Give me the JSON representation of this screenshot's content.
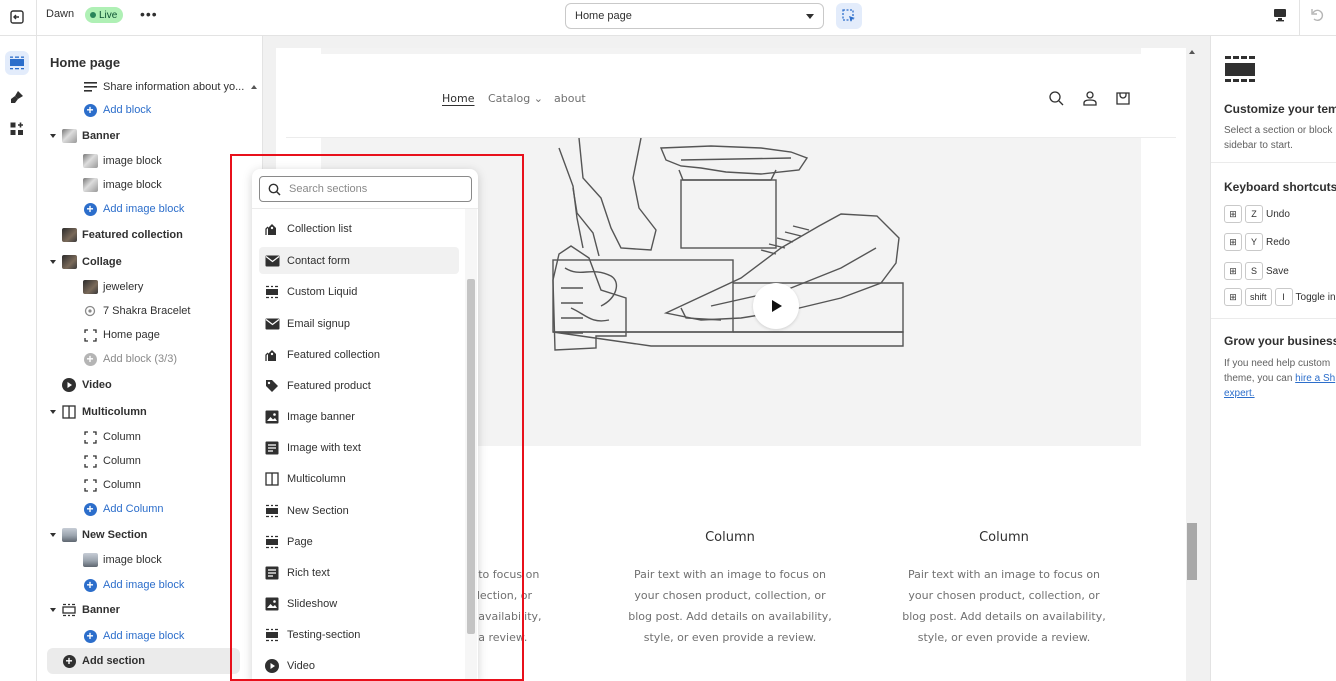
{
  "topbar": {
    "theme_name": "Dawn",
    "live_badge": "Live",
    "more_label": "•••",
    "template_select": "Home page"
  },
  "sidebar": {
    "title": "Home page",
    "items": [
      {
        "label": "Share information about yo...",
        "icon": "text-lines-icon"
      },
      {
        "label": "Add block",
        "icon": "add-circle-icon"
      },
      {
        "label": "Banner",
        "icon": "image-thumbnail"
      },
      {
        "label": "image block",
        "icon": "image-thumbnail"
      },
      {
        "label": "image block",
        "icon": "image-thumbnail"
      },
      {
        "label": "Add image block",
        "icon": "add-circle-icon"
      },
      {
        "label": "Featured collection",
        "icon": "image-thumbnail"
      },
      {
        "label": "Collage",
        "icon": "image-thumbnail"
      },
      {
        "label": "jewelery",
        "icon": "image-thumbnail"
      },
      {
        "label": "7 Shakra Bracelet",
        "icon": "product-icon"
      },
      {
        "label": "Home page",
        "icon": "frame-icon"
      },
      {
        "label": "Add block (3/3)",
        "icon": "add-circle-icon"
      },
      {
        "label": "Video",
        "icon": "play-icon"
      },
      {
        "label": "Multicolumn",
        "icon": "columns-icon"
      },
      {
        "label": "Column",
        "icon": "frame-icon"
      },
      {
        "label": "Column",
        "icon": "frame-icon"
      },
      {
        "label": "Column",
        "icon": "frame-icon"
      },
      {
        "label": "Add Column",
        "icon": "add-circle-icon"
      },
      {
        "label": "New Section",
        "icon": "image-thumbnail"
      },
      {
        "label": "image block",
        "icon": "image-thumbnail"
      },
      {
        "label": "Add image block",
        "icon": "add-circle-icon"
      },
      {
        "label": "Banner",
        "icon": "section-icon"
      },
      {
        "label": "Add image block",
        "icon": "add-circle-icon"
      }
    ],
    "add_section": "Add section"
  },
  "popover": {
    "search_placeholder": "Search sections",
    "items": [
      {
        "label": "Collection list",
        "icon": "collection-icon"
      },
      {
        "label": "Contact form",
        "icon": "envelope-icon"
      },
      {
        "label": "Custom Liquid",
        "icon": "section-icon"
      },
      {
        "label": "Email signup",
        "icon": "envelope-icon"
      },
      {
        "label": "Featured collection",
        "icon": "collection-icon"
      },
      {
        "label": "Featured product",
        "icon": "tag-icon"
      },
      {
        "label": "Image banner",
        "icon": "image-icon"
      },
      {
        "label": "Image with text",
        "icon": "image-text-icon"
      },
      {
        "label": "Multicolumn",
        "icon": "columns-icon"
      },
      {
        "label": "New Section",
        "icon": "section-icon"
      },
      {
        "label": "Page",
        "icon": "section-icon"
      },
      {
        "label": "Rich text",
        "icon": "text-icon"
      },
      {
        "label": "Slideshow",
        "icon": "image-icon"
      },
      {
        "label": "Testing-section",
        "icon": "section-icon"
      },
      {
        "label": "Video",
        "icon": "play-icon"
      }
    ]
  },
  "preview": {
    "nav": {
      "home": "Home",
      "catalog": "Catalog",
      "about": "about"
    },
    "columns": [
      {
        "title": "Column",
        "text": "Pair text with an image to focus on your chosen product, collection, or blog post. Add details on availability, style, or even provide a review."
      },
      {
        "title": "Column",
        "text": "Pair text with an image to focus on your chosen product, collection, or blog post. Add details on availability, style, or even provide a review."
      }
    ],
    "partial_text": [
      "ge to focus on",
      "collection, or",
      "on availability,",
      "de a review."
    ]
  },
  "right_panel": {
    "title": "Customize your temp",
    "desc_lines": [
      "Select a section or block",
      "sidebar to start."
    ],
    "shortcuts_title": "Keyboard shortcuts",
    "shortcuts": [
      {
        "key": "Z",
        "label": "Undo"
      },
      {
        "key": "Y",
        "label": "Redo"
      },
      {
        "key": "S",
        "label": "Save"
      },
      {
        "key": "I",
        "label": "Toggle in",
        "shift": "shift"
      }
    ],
    "grow_title": "Grow your business",
    "grow_lines": [
      "If you need help custom",
      "theme, you can",
      "expert."
    ],
    "grow_link": "hire a Sh"
  },
  "colors": {
    "accent": "#2c6ecb",
    "live_badge_bg": "#aff0b5",
    "highlight": "#e8101b"
  }
}
